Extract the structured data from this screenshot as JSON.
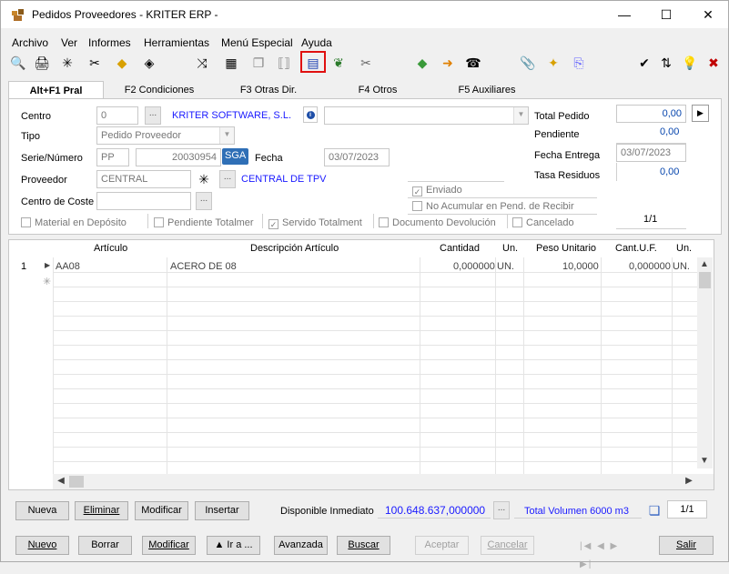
{
  "window": {
    "title": "Pedidos Proveedores - KRITER ERP -",
    "minimize": "—",
    "maximize": "☐",
    "close": "✕"
  },
  "menu": [
    "Archivo",
    "Ver",
    "Informes",
    "Herramientas",
    "Menú Especial",
    "Ayuda"
  ],
  "tabs": [
    "Alt+F1 Pral",
    "F2 Condiciones",
    "F3 Otras Dir.",
    "F4 Otros",
    "F5 Auxiliares"
  ],
  "header": {
    "centro_label": "Centro",
    "centro_value": "0",
    "centro_name": "KRITER SOFTWARE, S.L.",
    "tipo_label": "Tipo",
    "tipo_value": "Pedido Proveedor",
    "serie_label": "Serie/Número",
    "serie_value": "PP",
    "numero_value": "20030954",
    "sga_label": "SGA",
    "fecha_label": "Fecha",
    "fecha_value": "03/07/2023",
    "proveedor_label": "Proveedor",
    "proveedor_value": "CENTRAL",
    "proveedor_name": "CENTRAL DE TPV",
    "centro_coste_label": "Centro de Coste",
    "total_pedido_label": "Total Pedido",
    "total_pedido_value": "0,00",
    "pendiente_label": "Pendiente",
    "pendiente_value": "0,00",
    "fecha_entrega_label": "Fecha Entrega",
    "fecha_entrega_value": "03/07/2023",
    "tasa_residuos_label": "Tasa Residuos",
    "tasa_residuos_value": "0,00",
    "enviado_label": "Enviado",
    "no_acumular_label": "No Acumular en Pend. de Recibir",
    "page_counter": "1/1",
    "dots": "..."
  },
  "flags": {
    "material_deposito": "Material en Depósito",
    "pendiente_totalmer": "Pendiente Totalmer",
    "servido_totalment": "Servido Totalment",
    "documento_devolucion": "Documento Devolución",
    "cancelado": "Cancelado"
  },
  "grid": {
    "columns": [
      "Artículo",
      "Descripción Artículo",
      "Cantidad",
      "Un.",
      "Peso Unitario",
      "Cant.U.F.",
      "Un."
    ],
    "rows": [
      {
        "num": "1",
        "articulo": "AA08",
        "descripcion": "ACERO DE 08",
        "cantidad": "0,000000",
        "un": "UN.",
        "peso": "10,0000",
        "cant_uf": "0,000000",
        "un2": "UN."
      }
    ],
    "new_row_marker": "✳"
  },
  "line_buttons": {
    "nueva": "Nueva",
    "eliminar": "Eliminar",
    "modificar": "Modificar",
    "insertar": "Insertar",
    "disponible_label": "Disponible Inmediato",
    "disponible_value": "100.648.637,000000",
    "total_volumen": "Total Volumen  6000 m3",
    "page_counter": "1/1"
  },
  "bottom_buttons": {
    "nuevo": "Nuevo",
    "borrar": "Borrar",
    "modificar": "Modificar",
    "ira": "▲ Ir a ...",
    "avanzada": "Avanzada",
    "buscar": "Buscar",
    "aceptar": "Aceptar",
    "cancelar": "Cancelar",
    "nav": "|◀ ◀ ▶ ▶|",
    "salir": "Salir"
  },
  "colors": {
    "accent_blue": "#1a1aff",
    "sga_blue": "#2f6fb6",
    "highlight_red": "#e01010"
  }
}
